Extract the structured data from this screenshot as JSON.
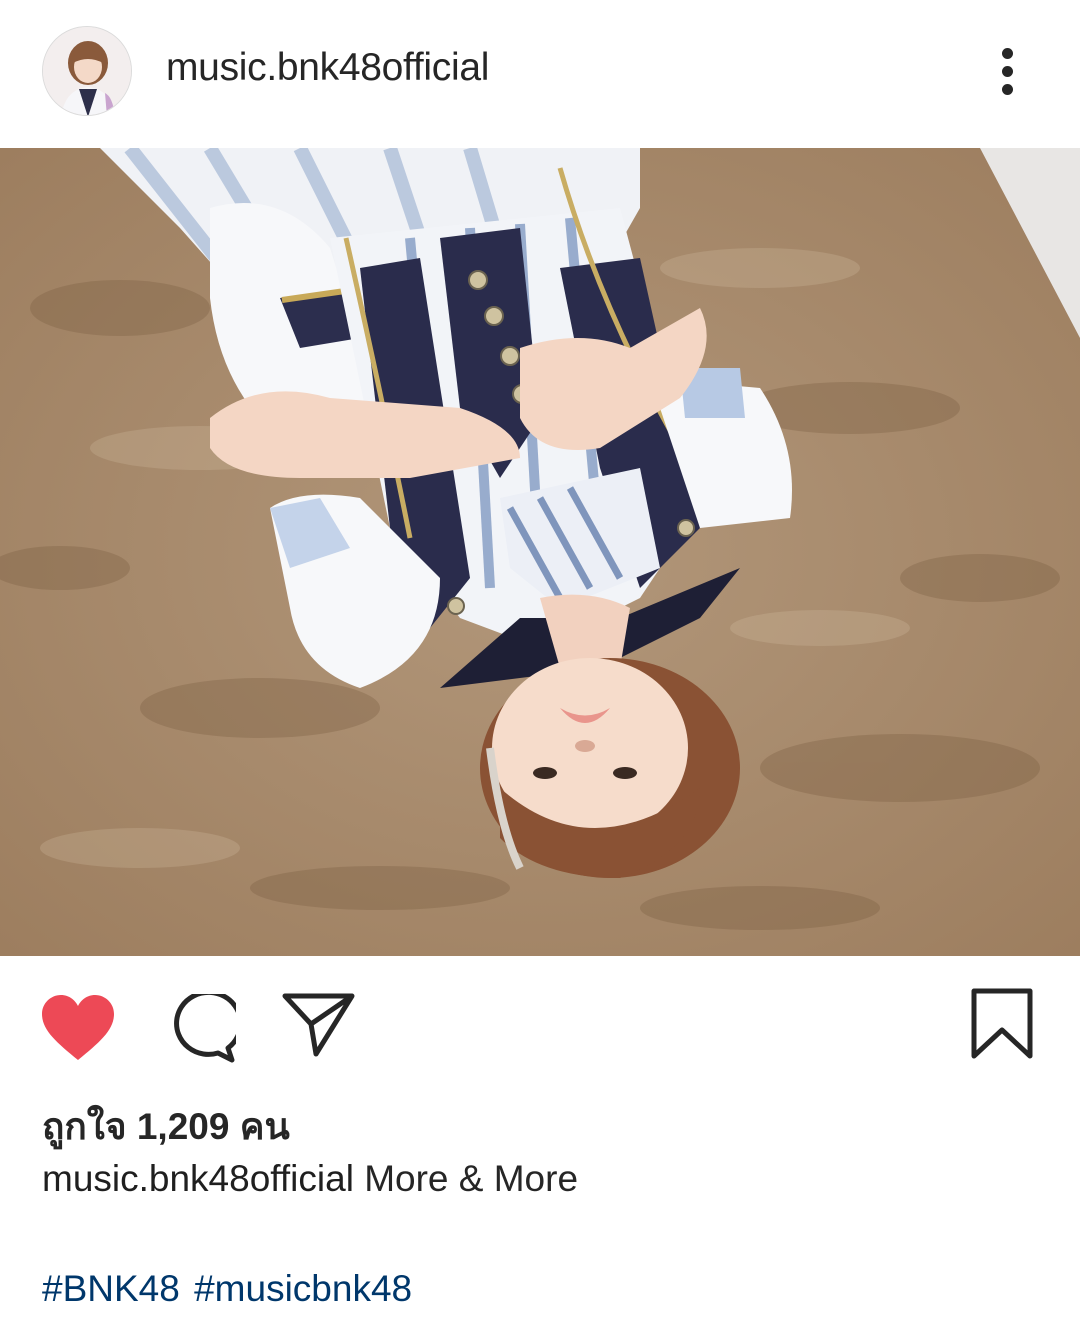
{
  "post": {
    "username": "music.bnk48official",
    "likes_text": "ถูกใจ 1,209 คน",
    "caption_user": "music.bnk48official",
    "caption_text": "More & More",
    "hashtags": [
      "#BNK48",
      "#musicbnk48"
    ]
  },
  "icons": {
    "avatar": "profile-avatar",
    "more": "more-vertical-icon",
    "like": "heart-filled-icon",
    "comment": "comment-bubble-icon",
    "share": "paper-plane-icon",
    "save": "bookmark-icon"
  },
  "colors": {
    "like_red": "#ed4956",
    "text": "#262626",
    "hashtag": "#00376b",
    "carpet": "#a98b6c",
    "background": "#ffffff"
  }
}
